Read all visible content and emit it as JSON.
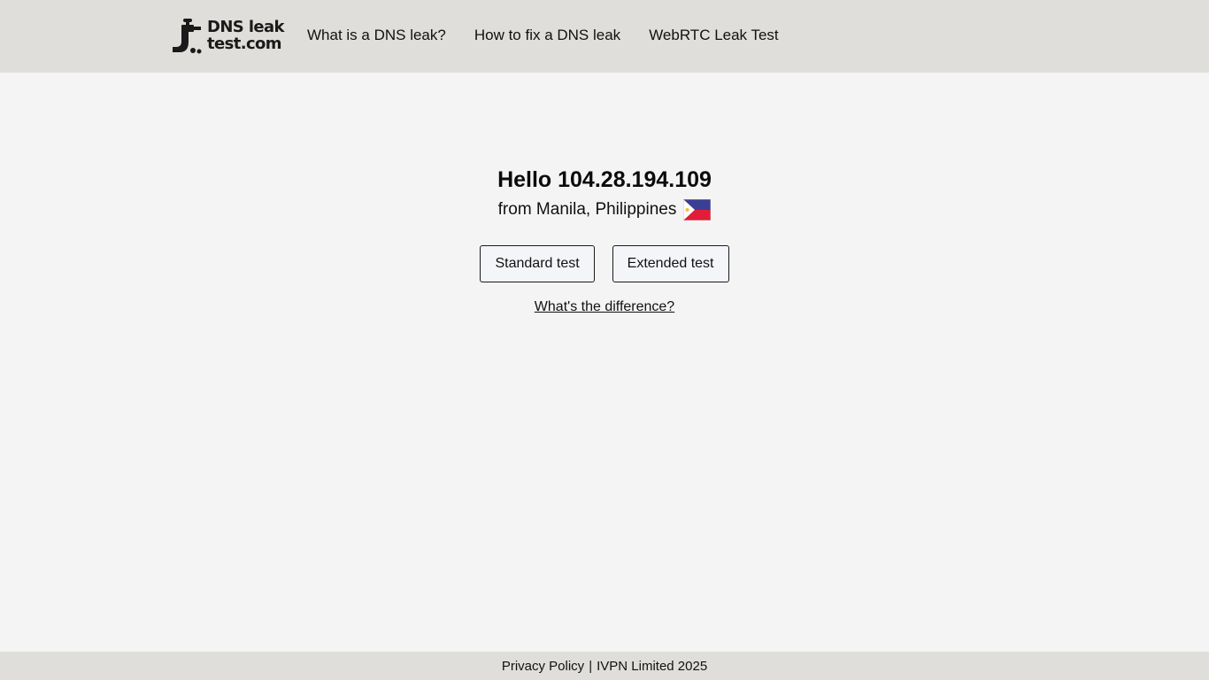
{
  "header": {
    "logo": {
      "line1": "DNS leak",
      "line2": "test.com",
      "icon": "faucet-icon"
    },
    "nav": [
      {
        "label": "What is a DNS leak?"
      },
      {
        "label": "How to fix a DNS leak"
      },
      {
        "label": "WebRTC Leak Test"
      }
    ]
  },
  "main": {
    "hello": "Hello 104.28.194.109",
    "location": "from Manila, Philippines",
    "flag": "philippines-flag-icon",
    "buttons": {
      "standard": "Standard test",
      "extended": "Extended test"
    },
    "difference_link": "What's the difference?"
  },
  "footer": {
    "privacy": "Privacy Policy",
    "separator": "|",
    "company": "IVPN Limited 2025"
  },
  "colors": {
    "header_bg": "#dfdeda",
    "page_bg": "#f4f4f4",
    "button_bg": "#f3f5f8",
    "flag_blue": "#3a3f94",
    "flag_red": "#e11d3a"
  }
}
